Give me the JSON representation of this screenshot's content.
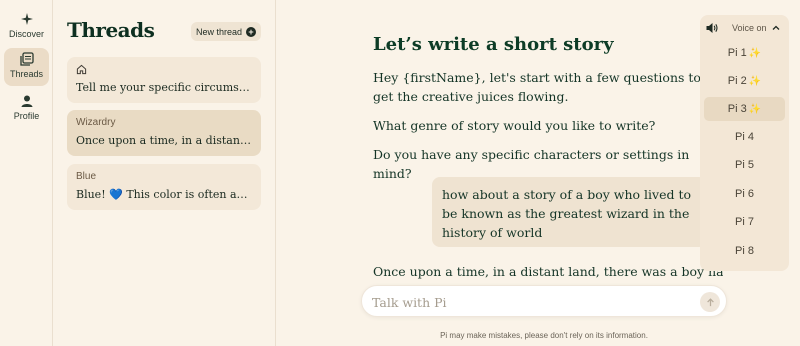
{
  "rail": {
    "discover": "Discover",
    "threads": "Threads",
    "profile": "Profile"
  },
  "threads_panel": {
    "title": "Threads",
    "new_thread": "New thread",
    "items": [
      {
        "label": "",
        "preview": "Tell me your specific circumstance..."
      },
      {
        "label": "Wizardry",
        "preview": "Once upon a time, in a distant lan..."
      },
      {
        "label": "Blue",
        "preview_prefix": "Blue!",
        "emoji": "💙",
        "preview_suffix": "This color is often associ..."
      }
    ]
  },
  "chat": {
    "title": "Let’s write a short story",
    "messages": [
      "Hey {firstName}, let's start with a few questions to get the creative juices flowing.",
      "What genre of story would you like to write?",
      "Do you have any specific characters or settings in mind?"
    ],
    "user_message": "how about a story of a boy who lived to be known as the greatest wizard in the history of world",
    "reply_start": "Once upon a time, in a distant land, there was a boy named",
    "input_placeholder": "Talk with Pi",
    "disclaimer": "Pi may make mistakes, please don't rely on its information."
  },
  "voice": {
    "label": "Voice on",
    "options": [
      {
        "name": "Pi 1",
        "starred": true,
        "selected": false
      },
      {
        "name": "Pi 2",
        "starred": true,
        "selected": false
      },
      {
        "name": "Pi 3",
        "starred": true,
        "selected": true
      },
      {
        "name": "Pi 4",
        "starred": false,
        "selected": false
      },
      {
        "name": "Pi 5",
        "starred": false,
        "selected": false
      },
      {
        "name": "Pi 6",
        "starred": false,
        "selected": false
      },
      {
        "name": "Pi 7",
        "starred": false,
        "selected": false
      },
      {
        "name": "Pi 8",
        "starred": false,
        "selected": false
      }
    ],
    "star_glyph": "✨"
  },
  "colors": {
    "background": "#faf3e8",
    "text": "#0d3c26",
    "active": "#ebdcc7"
  }
}
